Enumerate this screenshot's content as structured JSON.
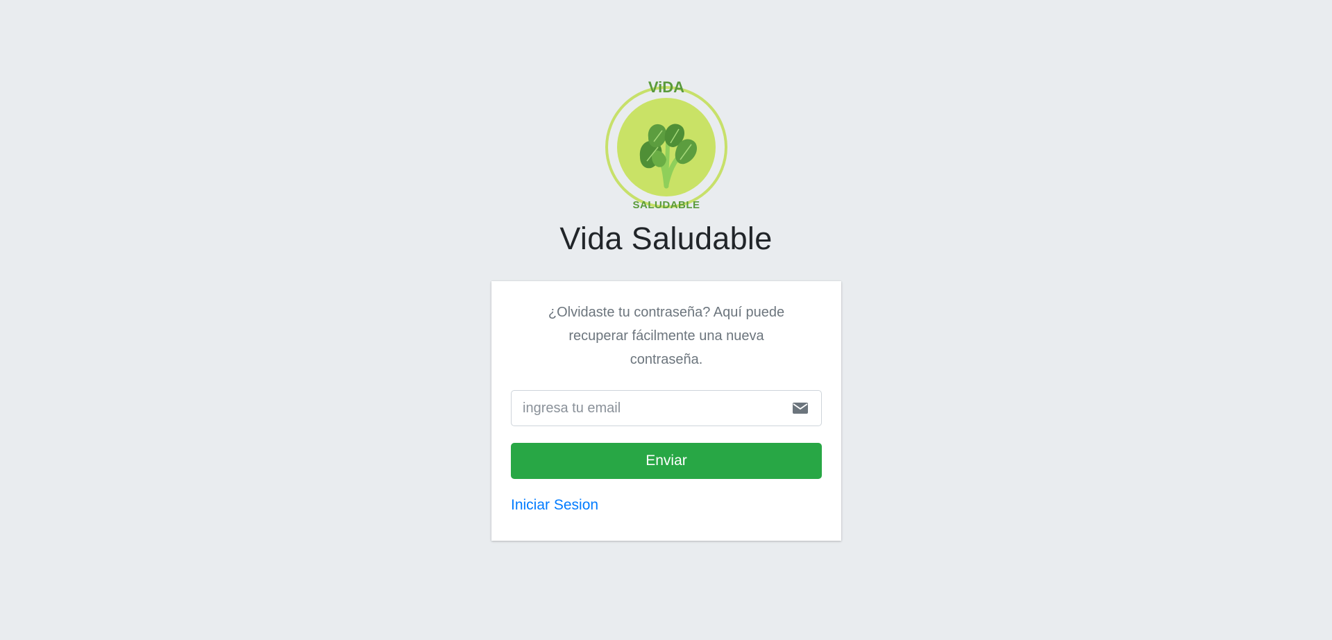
{
  "brand": {
    "logo_icon": "vida-saludable-logo",
    "logo_top_text": "ViDA",
    "logo_bottom_text": "SALUDABLE",
    "title": "Vida Saludable"
  },
  "recover": {
    "message": "¿Olvidaste tu contraseña? Aquí puede recuperar fácilmente una nueva contraseña.",
    "email_placeholder": "ingresa tu email",
    "email_value": "",
    "email_icon": "envelope-icon",
    "submit_label": "Enviar",
    "login_link_label": "Iniciar Sesion"
  },
  "colors": {
    "background": "#e9ecef",
    "primary_button": "#28a745",
    "link": "#007bff",
    "logo_ring": "#c7e06a",
    "logo_leaf": "#5a9a3c"
  }
}
